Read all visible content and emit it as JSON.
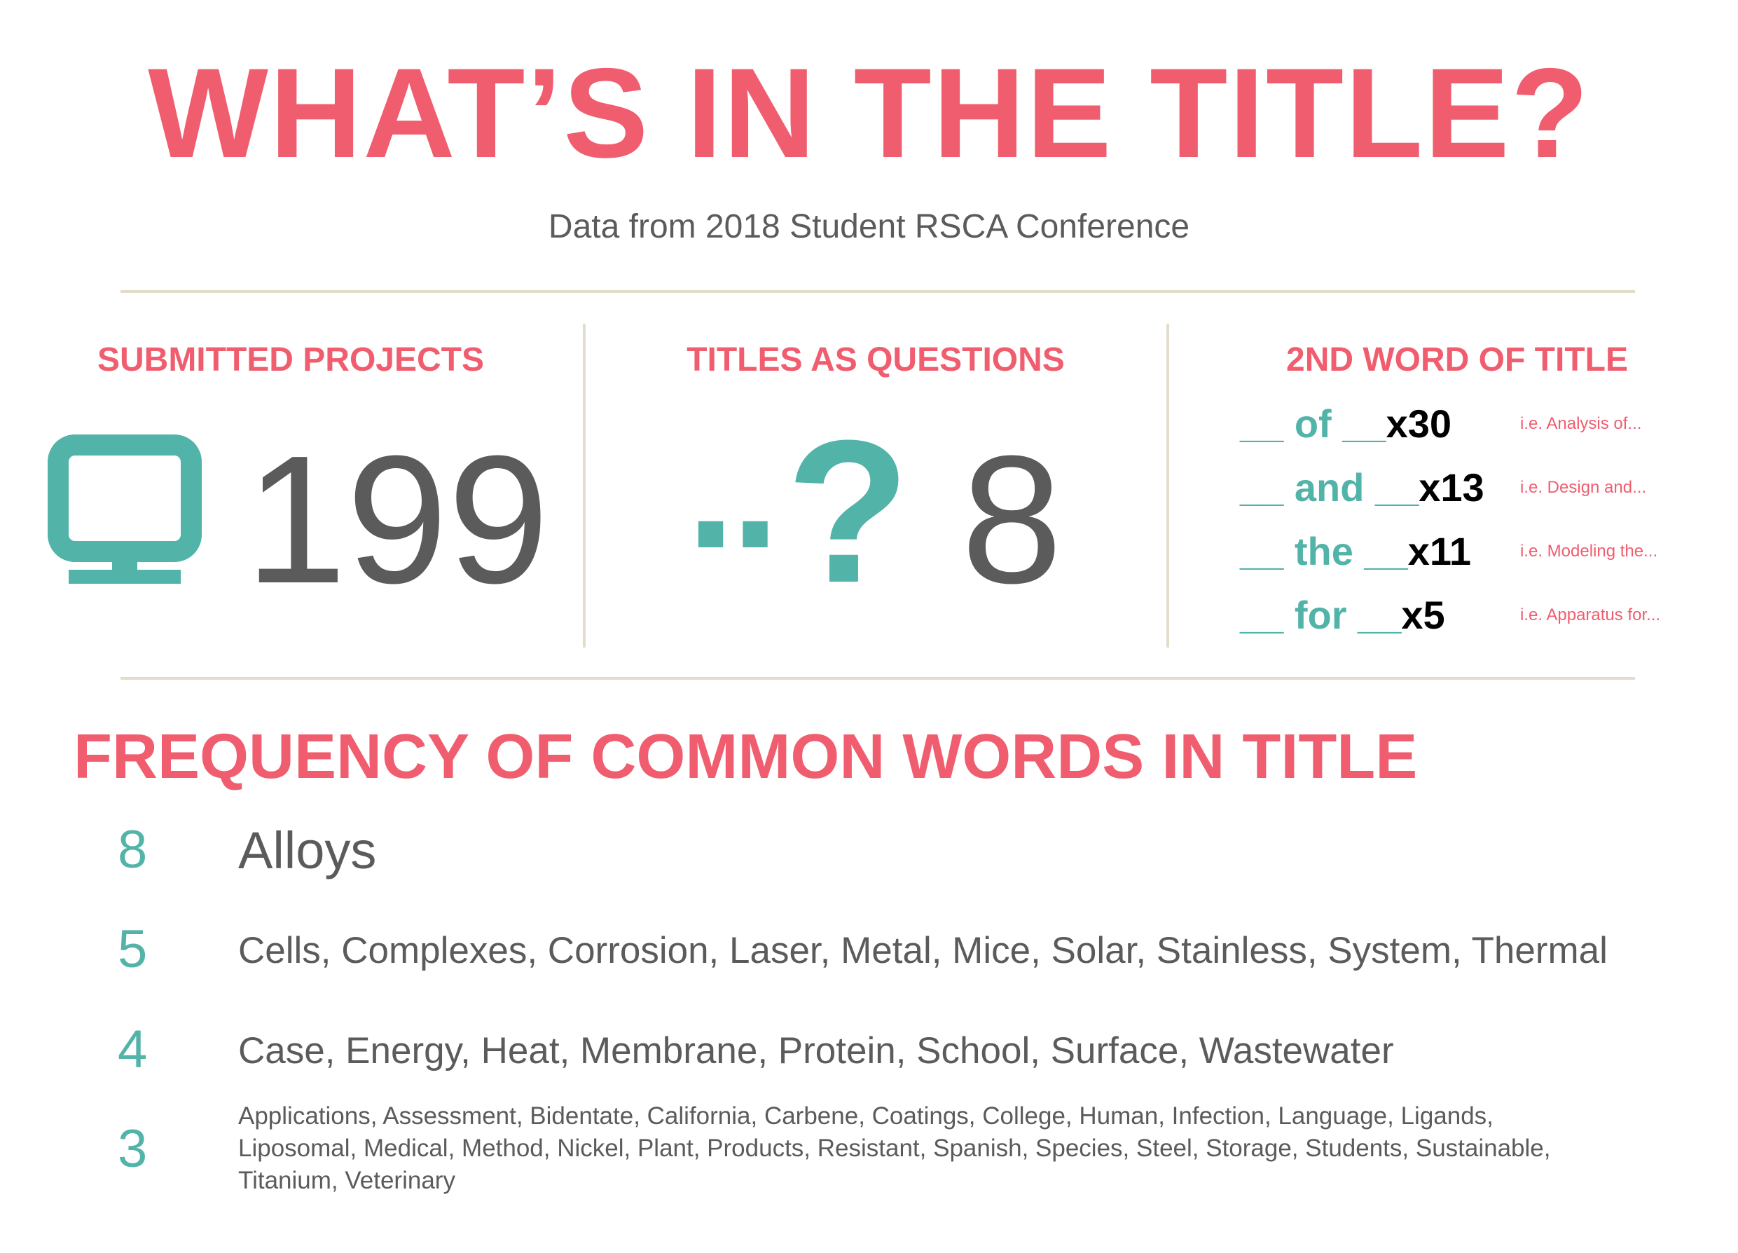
{
  "header": {
    "title": "WHAT’S IN THE TITLE?",
    "subtitle": "Data from 2018 Student RSCA Conference"
  },
  "colors": {
    "accent": "#f05d6e",
    "teal": "#52b3a9",
    "text": "#5b5b5b",
    "divider": "#e3dcc9"
  },
  "submitted": {
    "heading": "SUBMITTED PROJECTS",
    "icon": "monitor-icon",
    "value": "199"
  },
  "questions": {
    "heading": "TITLES AS QUESTIONS",
    "dots": "..",
    "mark": "?",
    "value": "8"
  },
  "second_word": {
    "heading": "2ND WORD OF TITLE",
    "rows": [
      {
        "pattern": "__ of __",
        "count": "x30",
        "example": "i.e. Analysis of..."
      },
      {
        "pattern": "__ and __",
        "count": "x13",
        "example": "i.e. Design and..."
      },
      {
        "pattern": "__ the __",
        "count": "x11",
        "example": "i.e. Modeling the..."
      },
      {
        "pattern": "__ for __",
        "count": "x5",
        "example": "i.e. Apparatus for..."
      }
    ]
  },
  "frequency": {
    "heading": "FREQUENCY OF COMMON WORDS IN TITLE",
    "groups": [
      {
        "count": "8",
        "words": "Alloys"
      },
      {
        "count": "5",
        "words": "Cells, Complexes, Corrosion, Laser, Metal, Mice, Solar, Stainless, System, Thermal"
      },
      {
        "count": "4",
        "words": "Case, Energy, Heat, Membrane, Protein, School, Surface, Wastewater"
      },
      {
        "count": "3",
        "words": "Applications, Assessment, Bidentate, California, Carbene, Coatings, College, Human, Infection, Language, Ligands, Liposomal, Medical, Method, Nickel, Plant, Products, Resistant, Spanish, Species, Steel, Storage, Students, Sustainable, Titanium, Veterinary"
      }
    ]
  }
}
